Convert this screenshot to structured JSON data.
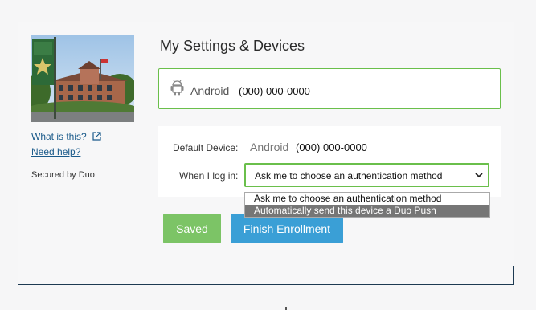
{
  "sidebar": {
    "image_alt": "Campus building with banner",
    "what_is_this": "What is this?",
    "need_help": "Need help?",
    "secured_by": "Secured by Duo"
  },
  "main": {
    "title": "My Settings & Devices",
    "device_card": {
      "name": "Android",
      "number": "(000) 000-0000",
      "icon": "android-icon"
    },
    "default_device_label": "Default Device:",
    "default_device_name": "Android",
    "default_device_number": "(000) 000-0000",
    "login_label": "When I log in:",
    "login_selected": "Ask me to choose an authentication method",
    "login_options": [
      "Ask me to choose an authentication method",
      "Automatically send this device a Duo Push"
    ],
    "saved_button": "Saved",
    "finish_button": "Finish Enrollment"
  },
  "colors": {
    "accent_green": "#6abf4b",
    "saved_green": "#7cc466",
    "finish_blue": "#3a9fd6",
    "frame_border": "#1d3a52",
    "link": "#1a5a8a"
  }
}
